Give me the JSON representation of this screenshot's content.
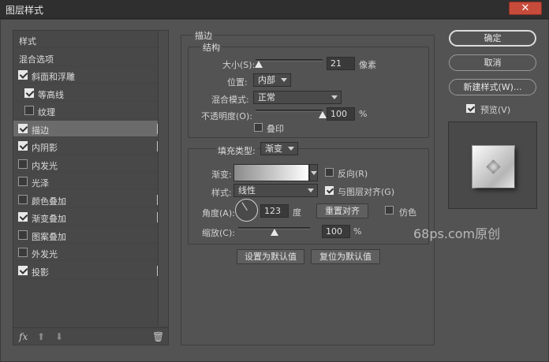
{
  "window": {
    "title": "图层样式",
    "close": "✕"
  },
  "left_items": [
    {
      "label": "样式",
      "checkbox": false,
      "plus": false,
      "selected": false,
      "checked": false,
      "indent": false
    },
    {
      "label": "混合选项",
      "checkbox": false,
      "plus": false,
      "selected": false,
      "checked": false,
      "indent": false
    },
    {
      "label": "斜面和浮雕",
      "checkbox": true,
      "checked": true,
      "plus": false,
      "selected": false,
      "indent": false
    },
    {
      "label": "等高线",
      "checkbox": true,
      "checked": true,
      "plus": false,
      "selected": false,
      "indent": true
    },
    {
      "label": "纹理",
      "checkbox": true,
      "checked": false,
      "plus": false,
      "selected": false,
      "indent": true
    },
    {
      "label": "描边",
      "checkbox": true,
      "checked": true,
      "plus": true,
      "selected": true,
      "indent": false
    },
    {
      "label": "内阴影",
      "checkbox": true,
      "checked": true,
      "plus": true,
      "selected": false,
      "indent": false
    },
    {
      "label": "内发光",
      "checkbox": true,
      "checked": false,
      "plus": false,
      "selected": false,
      "indent": false
    },
    {
      "label": "光泽",
      "checkbox": true,
      "checked": false,
      "plus": false,
      "selected": false,
      "indent": false
    },
    {
      "label": "颜色叠加",
      "checkbox": true,
      "checked": false,
      "plus": true,
      "selected": false,
      "indent": false
    },
    {
      "label": "渐变叠加",
      "checkbox": true,
      "checked": true,
      "plus": true,
      "selected": false,
      "indent": false
    },
    {
      "label": "图案叠加",
      "checkbox": true,
      "checked": false,
      "plus": false,
      "selected": false,
      "indent": false
    },
    {
      "label": "外发光",
      "checkbox": true,
      "checked": false,
      "plus": false,
      "selected": false,
      "indent": false
    },
    {
      "label": "投影",
      "checkbox": true,
      "checked": true,
      "plus": true,
      "selected": false,
      "indent": false
    }
  ],
  "tools": {
    "fx": "fx",
    "up": "⬆",
    "down": "⬇",
    "trash": "🗑"
  },
  "stroke": {
    "section_title": "描边",
    "structure_title": "结构",
    "size_label": "大小(S):",
    "size_value": "21",
    "size_unit": "像素",
    "size_level": 0.05,
    "position_label": "位置:",
    "position_value": "内部",
    "blend_label": "混合模式:",
    "blend_value": "正常",
    "opacity_label": "不透明度(O):",
    "opacity_value": "100",
    "opacity_unit": "%",
    "opacity_level": 1.0,
    "overprint_label": "叠印",
    "overprint_checked": false,
    "fill_type_label": "填充类型:",
    "fill_type_value": "渐变",
    "gradient_label": "渐变:",
    "reverse_label": "反向(R)",
    "reverse_checked": false,
    "style_label": "样式:",
    "style_value": "线性",
    "align_label": "与图层对齐(G)",
    "align_checked": true,
    "angle_label": "角度(A):",
    "angle_value": "123",
    "angle_unit": "度",
    "reset_align_label": "重置对齐",
    "dither_label": "仿色",
    "dither_checked": false,
    "scale_label": "缩放(C):",
    "scale_value": "100",
    "scale_unit": "%",
    "scale_level": 0.5,
    "set_default_label": "设置为默认值",
    "reset_default_label": "复位为默认值"
  },
  "right": {
    "ok": "确定",
    "cancel": "取消",
    "new_style": "新建样式(W)...",
    "preview_label": "预览(V)",
    "preview_checked": true
  },
  "watermark": "68ps.com原创"
}
